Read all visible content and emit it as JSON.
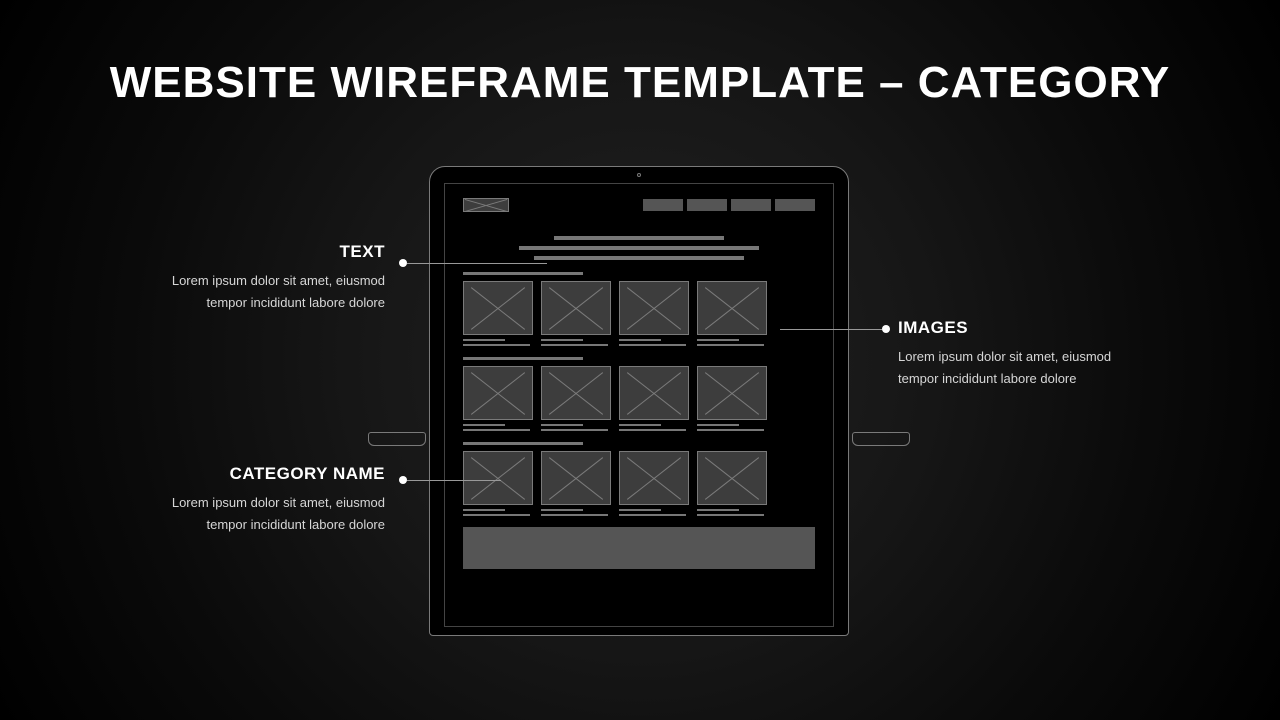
{
  "slide": {
    "title": "WEBSITE WIREFRAME TEMPLATE – CATEGORY"
  },
  "callouts": {
    "text": {
      "heading": "TEXT",
      "body": "Lorem ipsum dolor sit amet, eiusmod tempor incididunt labore dolore"
    },
    "category": {
      "heading": "CATEGORY NAME",
      "body": "Lorem ipsum dolor sit amet, eiusmod tempor incididunt labore dolore"
    },
    "images": {
      "heading": "IMAGES",
      "body": "Lorem ipsum dolor sit amet, eiusmod tempor incididunt labore dolore"
    }
  },
  "wireframe": {
    "nav_item_count": 4,
    "category_rows": 3,
    "thumbs_per_row": 4
  }
}
